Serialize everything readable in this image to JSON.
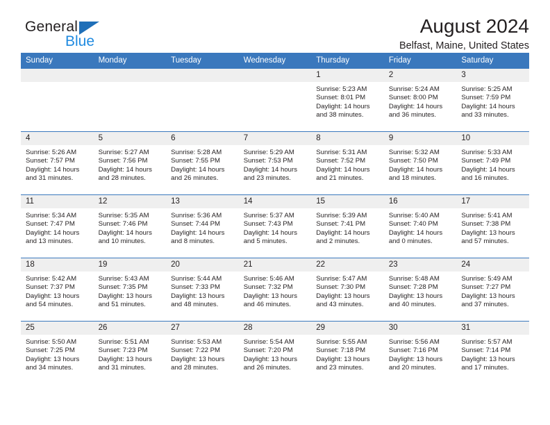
{
  "brand": {
    "line1": "General",
    "line2": "Blue",
    "triangle_color": "#1f6fb8",
    "blue_text_color": "#1f8ae0"
  },
  "header": {
    "title": "August 2024",
    "location": "Belfast, Maine, United States",
    "header_bg": "#3a78bd",
    "daynum_bg": "#efefef"
  },
  "weekdays": [
    "Sunday",
    "Monday",
    "Tuesday",
    "Wednesday",
    "Thursday",
    "Friday",
    "Saturday"
  ],
  "labels": {
    "sunrise_prefix": "Sunrise: ",
    "sunset_prefix": "Sunset: ",
    "daylight_prefix": "Daylight: "
  },
  "weeks": [
    [
      {
        "day": "",
        "empty": true
      },
      {
        "day": "",
        "empty": true
      },
      {
        "day": "",
        "empty": true
      },
      {
        "day": "",
        "empty": true
      },
      {
        "day": "1",
        "sunrise": "Sunrise: 5:23 AM",
        "sunset": "Sunset: 8:01 PM",
        "daylight": "Daylight: 14 hours and 38 minutes."
      },
      {
        "day": "2",
        "sunrise": "Sunrise: 5:24 AM",
        "sunset": "Sunset: 8:00 PM",
        "daylight": "Daylight: 14 hours and 36 minutes."
      },
      {
        "day": "3",
        "sunrise": "Sunrise: 5:25 AM",
        "sunset": "Sunset: 7:59 PM",
        "daylight": "Daylight: 14 hours and 33 minutes."
      }
    ],
    [
      {
        "day": "4",
        "sunrise": "Sunrise: 5:26 AM",
        "sunset": "Sunset: 7:57 PM",
        "daylight": "Daylight: 14 hours and 31 minutes."
      },
      {
        "day": "5",
        "sunrise": "Sunrise: 5:27 AM",
        "sunset": "Sunset: 7:56 PM",
        "daylight": "Daylight: 14 hours and 28 minutes."
      },
      {
        "day": "6",
        "sunrise": "Sunrise: 5:28 AM",
        "sunset": "Sunset: 7:55 PM",
        "daylight": "Daylight: 14 hours and 26 minutes."
      },
      {
        "day": "7",
        "sunrise": "Sunrise: 5:29 AM",
        "sunset": "Sunset: 7:53 PM",
        "daylight": "Daylight: 14 hours and 23 minutes."
      },
      {
        "day": "8",
        "sunrise": "Sunrise: 5:31 AM",
        "sunset": "Sunset: 7:52 PM",
        "daylight": "Daylight: 14 hours and 21 minutes."
      },
      {
        "day": "9",
        "sunrise": "Sunrise: 5:32 AM",
        "sunset": "Sunset: 7:50 PM",
        "daylight": "Daylight: 14 hours and 18 minutes."
      },
      {
        "day": "10",
        "sunrise": "Sunrise: 5:33 AM",
        "sunset": "Sunset: 7:49 PM",
        "daylight": "Daylight: 14 hours and 16 minutes."
      }
    ],
    [
      {
        "day": "11",
        "sunrise": "Sunrise: 5:34 AM",
        "sunset": "Sunset: 7:47 PM",
        "daylight": "Daylight: 14 hours and 13 minutes."
      },
      {
        "day": "12",
        "sunrise": "Sunrise: 5:35 AM",
        "sunset": "Sunset: 7:46 PM",
        "daylight": "Daylight: 14 hours and 10 minutes."
      },
      {
        "day": "13",
        "sunrise": "Sunrise: 5:36 AM",
        "sunset": "Sunset: 7:44 PM",
        "daylight": "Daylight: 14 hours and 8 minutes."
      },
      {
        "day": "14",
        "sunrise": "Sunrise: 5:37 AM",
        "sunset": "Sunset: 7:43 PM",
        "daylight": "Daylight: 14 hours and 5 minutes."
      },
      {
        "day": "15",
        "sunrise": "Sunrise: 5:39 AM",
        "sunset": "Sunset: 7:41 PM",
        "daylight": "Daylight: 14 hours and 2 minutes."
      },
      {
        "day": "16",
        "sunrise": "Sunrise: 5:40 AM",
        "sunset": "Sunset: 7:40 PM",
        "daylight": "Daylight: 14 hours and 0 minutes."
      },
      {
        "day": "17",
        "sunrise": "Sunrise: 5:41 AM",
        "sunset": "Sunset: 7:38 PM",
        "daylight": "Daylight: 13 hours and 57 minutes."
      }
    ],
    [
      {
        "day": "18",
        "sunrise": "Sunrise: 5:42 AM",
        "sunset": "Sunset: 7:37 PM",
        "daylight": "Daylight: 13 hours and 54 minutes."
      },
      {
        "day": "19",
        "sunrise": "Sunrise: 5:43 AM",
        "sunset": "Sunset: 7:35 PM",
        "daylight": "Daylight: 13 hours and 51 minutes."
      },
      {
        "day": "20",
        "sunrise": "Sunrise: 5:44 AM",
        "sunset": "Sunset: 7:33 PM",
        "daylight": "Daylight: 13 hours and 48 minutes."
      },
      {
        "day": "21",
        "sunrise": "Sunrise: 5:46 AM",
        "sunset": "Sunset: 7:32 PM",
        "daylight": "Daylight: 13 hours and 46 minutes."
      },
      {
        "day": "22",
        "sunrise": "Sunrise: 5:47 AM",
        "sunset": "Sunset: 7:30 PM",
        "daylight": "Daylight: 13 hours and 43 minutes."
      },
      {
        "day": "23",
        "sunrise": "Sunrise: 5:48 AM",
        "sunset": "Sunset: 7:28 PM",
        "daylight": "Daylight: 13 hours and 40 minutes."
      },
      {
        "day": "24",
        "sunrise": "Sunrise: 5:49 AM",
        "sunset": "Sunset: 7:27 PM",
        "daylight": "Daylight: 13 hours and 37 minutes."
      }
    ],
    [
      {
        "day": "25",
        "sunrise": "Sunrise: 5:50 AM",
        "sunset": "Sunset: 7:25 PM",
        "daylight": "Daylight: 13 hours and 34 minutes."
      },
      {
        "day": "26",
        "sunrise": "Sunrise: 5:51 AM",
        "sunset": "Sunset: 7:23 PM",
        "daylight": "Daylight: 13 hours and 31 minutes."
      },
      {
        "day": "27",
        "sunrise": "Sunrise: 5:53 AM",
        "sunset": "Sunset: 7:22 PM",
        "daylight": "Daylight: 13 hours and 28 minutes."
      },
      {
        "day": "28",
        "sunrise": "Sunrise: 5:54 AM",
        "sunset": "Sunset: 7:20 PM",
        "daylight": "Daylight: 13 hours and 26 minutes."
      },
      {
        "day": "29",
        "sunrise": "Sunrise: 5:55 AM",
        "sunset": "Sunset: 7:18 PM",
        "daylight": "Daylight: 13 hours and 23 minutes."
      },
      {
        "day": "30",
        "sunrise": "Sunrise: 5:56 AM",
        "sunset": "Sunset: 7:16 PM",
        "daylight": "Daylight: 13 hours and 20 minutes."
      },
      {
        "day": "31",
        "sunrise": "Sunrise: 5:57 AM",
        "sunset": "Sunset: 7:14 PM",
        "daylight": "Daylight: 13 hours and 17 minutes."
      }
    ]
  ]
}
